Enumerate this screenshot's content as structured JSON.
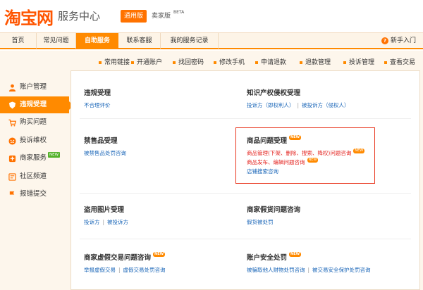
{
  "header": {
    "logo": "淘宝网",
    "service_title": "服务中心",
    "version_general": "通用版",
    "version_seller": "卖家版",
    "beta": "BETA"
  },
  "nav": {
    "items": [
      {
        "label": "首页"
      },
      {
        "label": "常见问题"
      },
      {
        "label": "自助服务"
      },
      {
        "label": "联系客服"
      },
      {
        "label": "我的服务记录"
      }
    ],
    "active": "自助服务",
    "helper": "新手入门"
  },
  "quick_links": [
    "常用链接",
    "开通账户",
    "找回密码",
    "修改手机",
    "申请退款",
    "退款管理",
    "投诉管理",
    "查看交易"
  ],
  "sidebar": {
    "items": [
      {
        "label": "账户管理",
        "icon": "user-icon"
      },
      {
        "label": "违规受理",
        "icon": "shield-icon"
      },
      {
        "label": "购买问题",
        "icon": "cart-icon"
      },
      {
        "label": "投诉维权",
        "icon": "complaint-icon"
      },
      {
        "label": "商家服务",
        "icon": "store-icon",
        "badge": "NEW"
      },
      {
        "label": "社区频道",
        "icon": "community-icon"
      },
      {
        "label": "报错提交",
        "icon": "report-icon"
      }
    ],
    "active": "违规受理"
  },
  "sections": {
    "violation": {
      "title": "违规受理",
      "links": [
        "不合理评价"
      ]
    },
    "ip": {
      "title": "知识产权侵权受理",
      "links": [
        "投诉方（即权利人）",
        "被投诉方（侵权人）"
      ]
    },
    "prohibited": {
      "title": "禁售品受理",
      "links": [
        "被禁售品处罚咨询"
      ]
    },
    "goods": {
      "title": "商品问题受理",
      "badge": "NEW",
      "links": [
        "商品管理(下架、删除、搜索、降权)问题咨询",
        "商品发布、编辑问题咨询",
        "店铺搜索咨询"
      ]
    },
    "image": {
      "title": "盗用图片受理",
      "links": [
        "投诉方",
        "被投诉方"
      ]
    },
    "fake": {
      "title": "商家假货问题咨询",
      "links": [
        "假货被处罚"
      ]
    },
    "virtual": {
      "title": "商家虚假交易问题咨询",
      "badge": "NEW",
      "links": [
        "举报虚假交易",
        "虚假交易处罚咨询"
      ]
    },
    "security": {
      "title": "账户安全处罚",
      "badge": "NEW",
      "links": [
        "被骗取他人财物处罚咨询",
        "被交易安全保护处罚咨询"
      ]
    }
  },
  "colors": {
    "accent": "#ff8a00",
    "brand": "#ff5500",
    "link": "#1a66b8",
    "highlight": "#e4231f"
  }
}
